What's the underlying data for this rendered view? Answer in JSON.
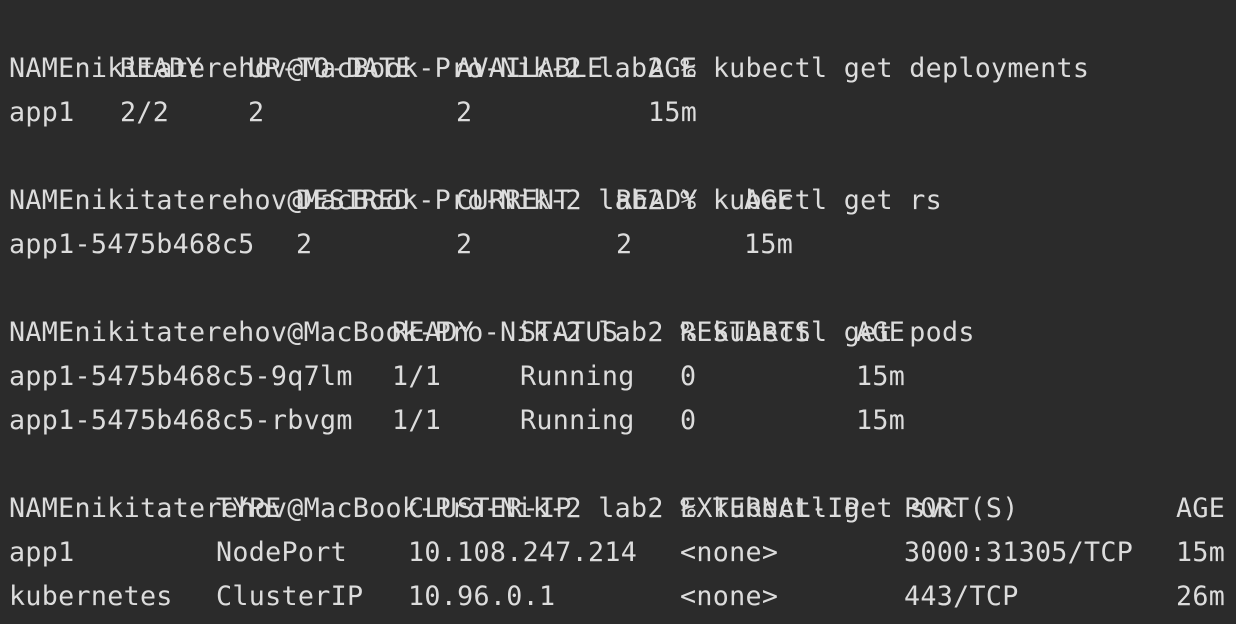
{
  "terminal": {
    "prompt": "nikitaterehov@MacBook-Pro-Nik-2 lab2 % ",
    "commands": [
      "kubectl get deployments",
      "kubectl get rs",
      "kubectl get pods",
      "kubectl get svc"
    ],
    "deployments": {
      "headers": [
        "NAME",
        "READY",
        "UP-TO-DATE",
        "AVAILABLE",
        "AGE"
      ],
      "rows": [
        [
          "app1",
          "2/2",
          "2",
          "2",
          "15m"
        ]
      ]
    },
    "rs": {
      "headers": [
        "NAME",
        "DESIRED",
        "CURRENT",
        "READY",
        "AGE"
      ],
      "rows": [
        [
          "app1-5475b468c5",
          "2",
          "2",
          "2",
          "15m"
        ]
      ]
    },
    "pods": {
      "headers": [
        "NAME",
        "READY",
        "STATUS",
        "RESTARTS",
        "AGE"
      ],
      "rows": [
        [
          "app1-5475b468c5-9q7lm",
          "1/1",
          "Running",
          "0",
          "15m"
        ],
        [
          "app1-5475b468c5-rbvgm",
          "1/1",
          "Running",
          "0",
          "15m"
        ]
      ]
    },
    "svc": {
      "headers": [
        "NAME",
        "TYPE",
        "CLUSTER-IP",
        "EXTERNAL-IP",
        "PORT(S)",
        "AGE"
      ],
      "rows": [
        [
          "app1",
          "NodePort",
          "10.108.247.214",
          "<none>",
          "3000:31305/TCP",
          "15m"
        ],
        [
          "kubernetes",
          "ClusterIP",
          "10.96.0.1",
          "<none>",
          "443/TCP",
          "26m"
        ]
      ]
    },
    "colors": {
      "background": "#2b2b2b",
      "text": "#dcdcdc"
    }
  }
}
